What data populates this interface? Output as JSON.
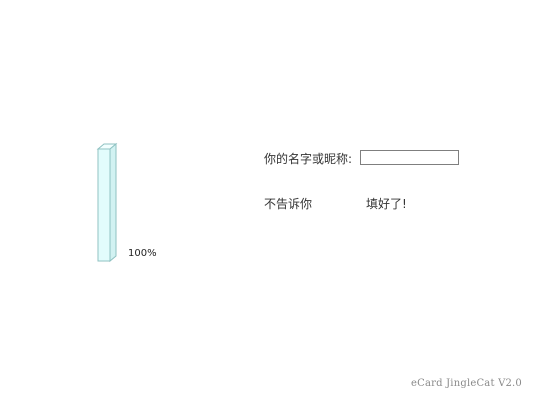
{
  "progress": {
    "value": 1.0,
    "label": "100%",
    "fill_color": "#e0fcfc",
    "edge_color": "#8fc2c2"
  },
  "form": {
    "name_label": "你的名字或昵称:",
    "name_value": "",
    "name_placeholder": ""
  },
  "actions": {
    "secret_label": "不告诉你",
    "done_label": "填好了!"
  },
  "footer": {
    "version_text": "eCard JingleCat V2.0"
  }
}
